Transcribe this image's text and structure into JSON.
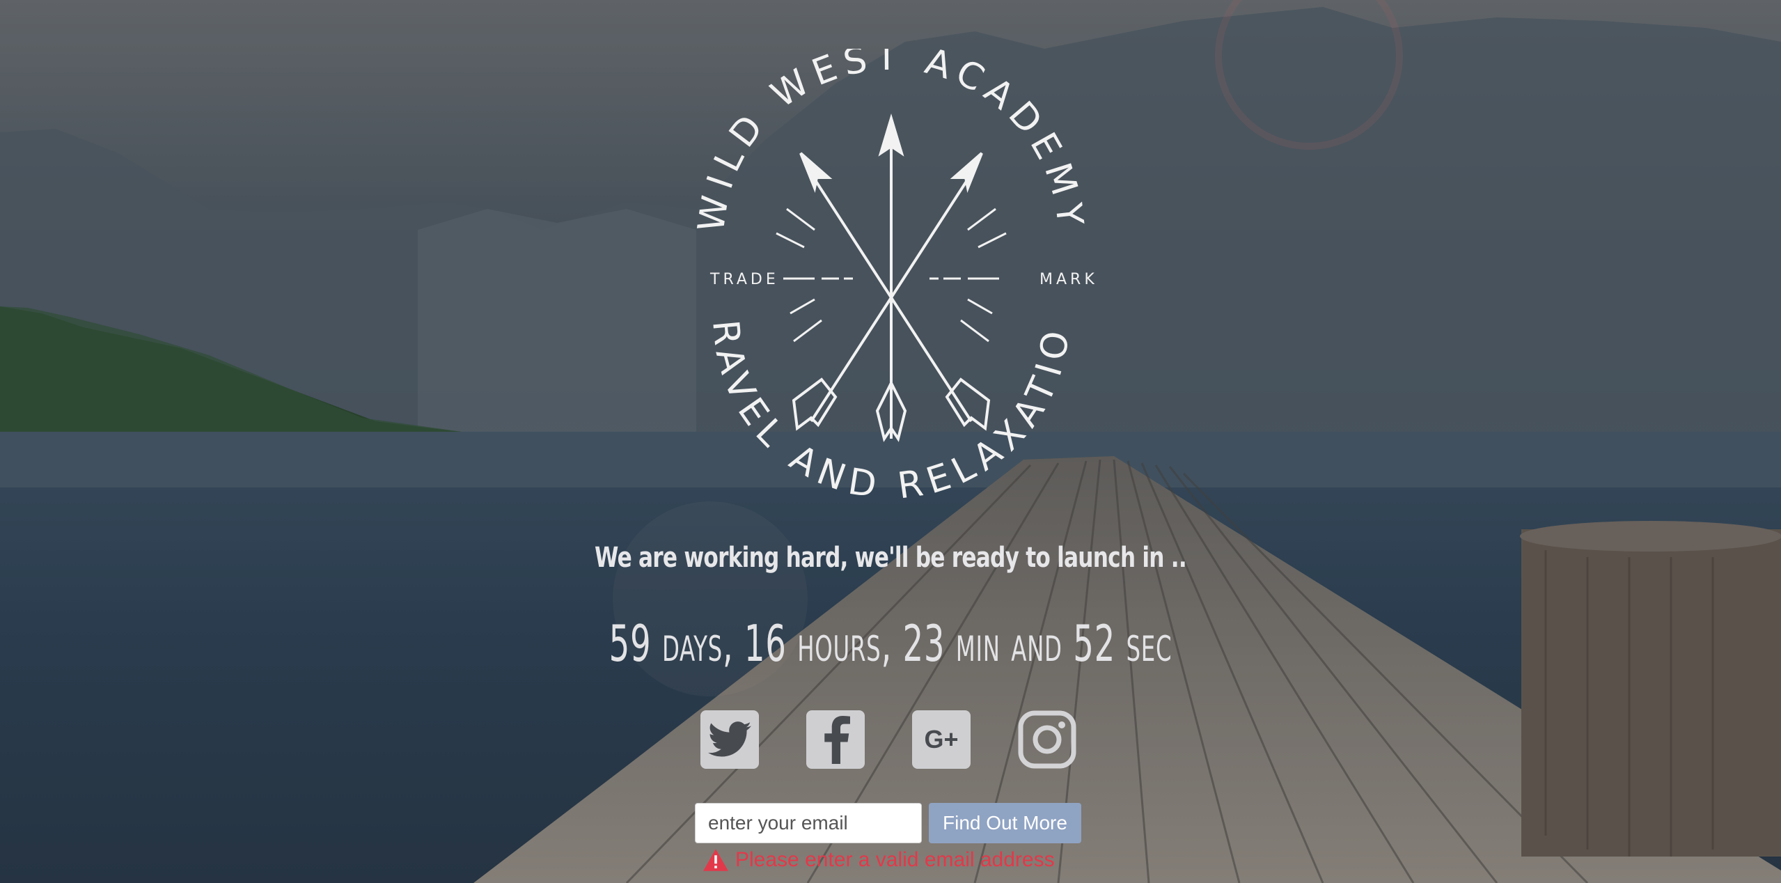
{
  "logo": {
    "top_text": "WILD WEST ACADEMY",
    "bottom_text": "TRAVEL AND RELAXATION",
    "left_mark": "TRADE",
    "right_mark": "MARK"
  },
  "tagline": "We are working hard, we'll be ready to launch in ..",
  "countdown": "59 days, 16 hours, 23 min and 52 sec",
  "social": [
    {
      "name": "twitter",
      "icon": "twitter-icon"
    },
    {
      "name": "facebook",
      "icon": "facebook-icon"
    },
    {
      "name": "google-plus",
      "icon": "google-plus-icon",
      "label": "G+"
    },
    {
      "name": "instagram",
      "icon": "instagram-icon"
    }
  ],
  "form": {
    "email_placeholder": "enter your email",
    "email_value": "",
    "submit_label": "Find Out More"
  },
  "error": {
    "message": "Please enter a valid email address",
    "color": "#e2394a"
  },
  "colors": {
    "button": "#8fa3c3",
    "text_light": "#e7e7ea"
  }
}
